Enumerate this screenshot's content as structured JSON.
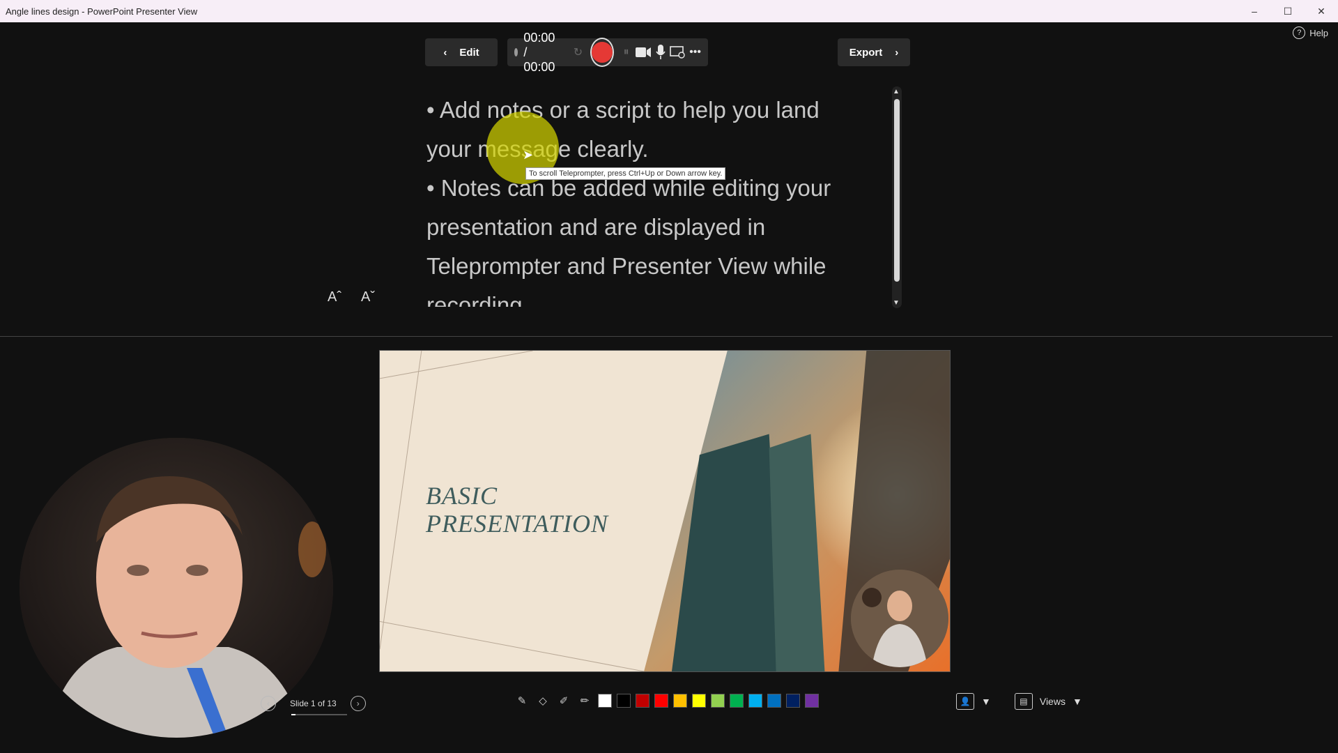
{
  "window": {
    "title": "Angle lines design - PowerPoint Presenter View",
    "minimize": "–",
    "maximize": "☐",
    "close": "✕"
  },
  "help": {
    "label": "Help",
    "icon": "?"
  },
  "toolbar": {
    "edit_label": "Edit",
    "timer": "00:00 / 00:00",
    "export_label": "Export",
    "icons": [
      "reset-icon",
      "record-icon",
      "pause-icon",
      "camera-icon",
      "microphone-icon",
      "screen-options-icon",
      "more-icon"
    ],
    "more": "•••"
  },
  "notes": {
    "lines": [
      "• Add notes or a script to help you land your message clearly.",
      "• Notes can be added while editing your presentation and are displayed in Teleprompter and Presenter View while recording."
    ],
    "increase_font": "Aˆ",
    "decrease_font": "Aˇ"
  },
  "tooltip": {
    "text": "To scroll Teleprompter, press Ctrl+Up or Down arrow key."
  },
  "slide": {
    "title_line1": "BASIC",
    "title_line2": "PRESENTATION"
  },
  "navigation": {
    "slide_count": "Slide 1 of 13",
    "progress": 0.08
  },
  "ink": {
    "tools": [
      "pen-icon",
      "eraser-icon",
      "pen-highlighter-icon",
      "highlighter-icon"
    ],
    "colors": [
      "#ffffff",
      "#000000",
      "#c00000",
      "#ff0000",
      "#ffc000",
      "#ffff00",
      "#92d050",
      "#00b050",
      "#00b0f0",
      "#0070c0",
      "#002060",
      "#7030a0"
    ]
  },
  "view_controls": {
    "views_label": "Views"
  }
}
